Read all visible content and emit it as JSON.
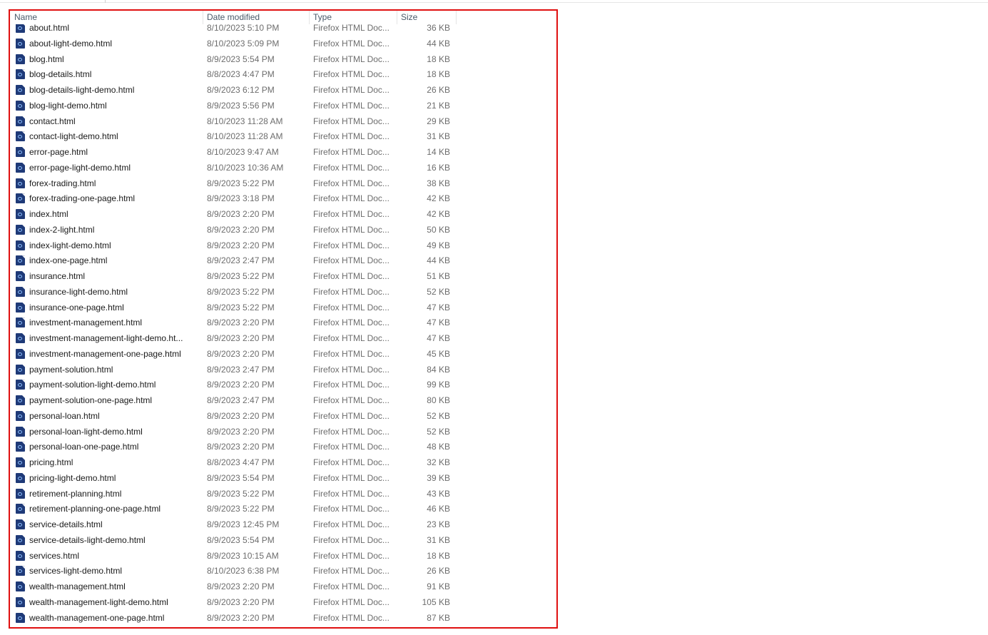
{
  "columns": {
    "name": "Name",
    "date": "Date modified",
    "type": "Type",
    "size": "Size"
  },
  "files": [
    {
      "name": "about.html",
      "date": "8/10/2023 5:10 PM",
      "type": "Firefox HTML Doc...",
      "size": "36 KB"
    },
    {
      "name": "about-light-demo.html",
      "date": "8/10/2023 5:09 PM",
      "type": "Firefox HTML Doc...",
      "size": "44 KB"
    },
    {
      "name": "blog.html",
      "date": "8/9/2023 5:54 PM",
      "type": "Firefox HTML Doc...",
      "size": "18 KB"
    },
    {
      "name": "blog-details.html",
      "date": "8/8/2023 4:47 PM",
      "type": "Firefox HTML Doc...",
      "size": "18 KB"
    },
    {
      "name": "blog-details-light-demo.html",
      "date": "8/9/2023 6:12 PM",
      "type": "Firefox HTML Doc...",
      "size": "26 KB"
    },
    {
      "name": "blog-light-demo.html",
      "date": "8/9/2023 5:56 PM",
      "type": "Firefox HTML Doc...",
      "size": "21 KB"
    },
    {
      "name": "contact.html",
      "date": "8/10/2023 11:28 AM",
      "type": "Firefox HTML Doc...",
      "size": "29 KB"
    },
    {
      "name": "contact-light-demo.html",
      "date": "8/10/2023 11:28 AM",
      "type": "Firefox HTML Doc...",
      "size": "31 KB"
    },
    {
      "name": "error-page.html",
      "date": "8/10/2023 9:47 AM",
      "type": "Firefox HTML Doc...",
      "size": "14 KB"
    },
    {
      "name": "error-page-light-demo.html",
      "date": "8/10/2023 10:36 AM",
      "type": "Firefox HTML Doc...",
      "size": "16 KB"
    },
    {
      "name": "forex-trading.html",
      "date": "8/9/2023 5:22 PM",
      "type": "Firefox HTML Doc...",
      "size": "38 KB"
    },
    {
      "name": "forex-trading-one-page.html",
      "date": "8/9/2023 3:18 PM",
      "type": "Firefox HTML Doc...",
      "size": "42 KB"
    },
    {
      "name": "index.html",
      "date": "8/9/2023 2:20 PM",
      "type": "Firefox HTML Doc...",
      "size": "42 KB"
    },
    {
      "name": "index-2-light.html",
      "date": "8/9/2023 2:20 PM",
      "type": "Firefox HTML Doc...",
      "size": "50 KB"
    },
    {
      "name": "index-light-demo.html",
      "date": "8/9/2023 2:20 PM",
      "type": "Firefox HTML Doc...",
      "size": "49 KB"
    },
    {
      "name": "index-one-page.html",
      "date": "8/9/2023 2:47 PM",
      "type": "Firefox HTML Doc...",
      "size": "44 KB"
    },
    {
      "name": "insurance.html",
      "date": "8/9/2023 5:22 PM",
      "type": "Firefox HTML Doc...",
      "size": "51 KB"
    },
    {
      "name": "insurance-light-demo.html",
      "date": "8/9/2023 5:22 PM",
      "type": "Firefox HTML Doc...",
      "size": "52 KB"
    },
    {
      "name": "insurance-one-page.html",
      "date": "8/9/2023 5:22 PM",
      "type": "Firefox HTML Doc...",
      "size": "47 KB"
    },
    {
      "name": "investment-management.html",
      "date": "8/9/2023 2:20 PM",
      "type": "Firefox HTML Doc...",
      "size": "47 KB"
    },
    {
      "name": "investment-management-light-demo.ht...",
      "date": "8/9/2023 2:20 PM",
      "type": "Firefox HTML Doc...",
      "size": "47 KB"
    },
    {
      "name": "investment-management-one-page.html",
      "date": "8/9/2023 2:20 PM",
      "type": "Firefox HTML Doc...",
      "size": "45 KB"
    },
    {
      "name": "payment-solution.html",
      "date": "8/9/2023 2:47 PM",
      "type": "Firefox HTML Doc...",
      "size": "84 KB"
    },
    {
      "name": "payment-solution-light-demo.html",
      "date": "8/9/2023 2:20 PM",
      "type": "Firefox HTML Doc...",
      "size": "99 KB"
    },
    {
      "name": "payment-solution-one-page.html",
      "date": "8/9/2023 2:47 PM",
      "type": "Firefox HTML Doc...",
      "size": "80 KB"
    },
    {
      "name": "personal-loan.html",
      "date": "8/9/2023 2:20 PM",
      "type": "Firefox HTML Doc...",
      "size": "52 KB"
    },
    {
      "name": "personal-loan-light-demo.html",
      "date": "8/9/2023 2:20 PM",
      "type": "Firefox HTML Doc...",
      "size": "52 KB"
    },
    {
      "name": "personal-loan-one-page.html",
      "date": "8/9/2023 2:20 PM",
      "type": "Firefox HTML Doc...",
      "size": "48 KB"
    },
    {
      "name": "pricing.html",
      "date": "8/8/2023 4:47 PM",
      "type": "Firefox HTML Doc...",
      "size": "32 KB"
    },
    {
      "name": "pricing-light-demo.html",
      "date": "8/9/2023 5:54 PM",
      "type": "Firefox HTML Doc...",
      "size": "39 KB"
    },
    {
      "name": "retirement-planning.html",
      "date": "8/9/2023 5:22 PM",
      "type": "Firefox HTML Doc...",
      "size": "43 KB"
    },
    {
      "name": "retirement-planning-one-page.html",
      "date": "8/9/2023 5:22 PM",
      "type": "Firefox HTML Doc...",
      "size": "46 KB"
    },
    {
      "name": "service-details.html",
      "date": "8/9/2023 12:45 PM",
      "type": "Firefox HTML Doc...",
      "size": "23 KB"
    },
    {
      "name": "service-details-light-demo.html",
      "date": "8/9/2023 5:54 PM",
      "type": "Firefox HTML Doc...",
      "size": "31 KB"
    },
    {
      "name": "services.html",
      "date": "8/9/2023 10:15 AM",
      "type": "Firefox HTML Doc...",
      "size": "18 KB"
    },
    {
      "name": "services-light-demo.html",
      "date": "8/10/2023 6:38 PM",
      "type": "Firefox HTML Doc...",
      "size": "26 KB"
    },
    {
      "name": "wealth-management.html",
      "date": "8/9/2023 2:20 PM",
      "type": "Firefox HTML Doc...",
      "size": "91 KB"
    },
    {
      "name": "wealth-management-light-demo.html",
      "date": "8/9/2023 2:20 PM",
      "type": "Firefox HTML Doc...",
      "size": "105 KB"
    },
    {
      "name": "wealth-management-one-page.html",
      "date": "8/9/2023 2:20 PM",
      "type": "Firefox HTML Doc...",
      "size": "87 KB"
    }
  ],
  "icons": {
    "file": "firefox-html-file-icon"
  },
  "colors": {
    "highlight_border": "#e01010",
    "icon": "#1f3a78"
  }
}
